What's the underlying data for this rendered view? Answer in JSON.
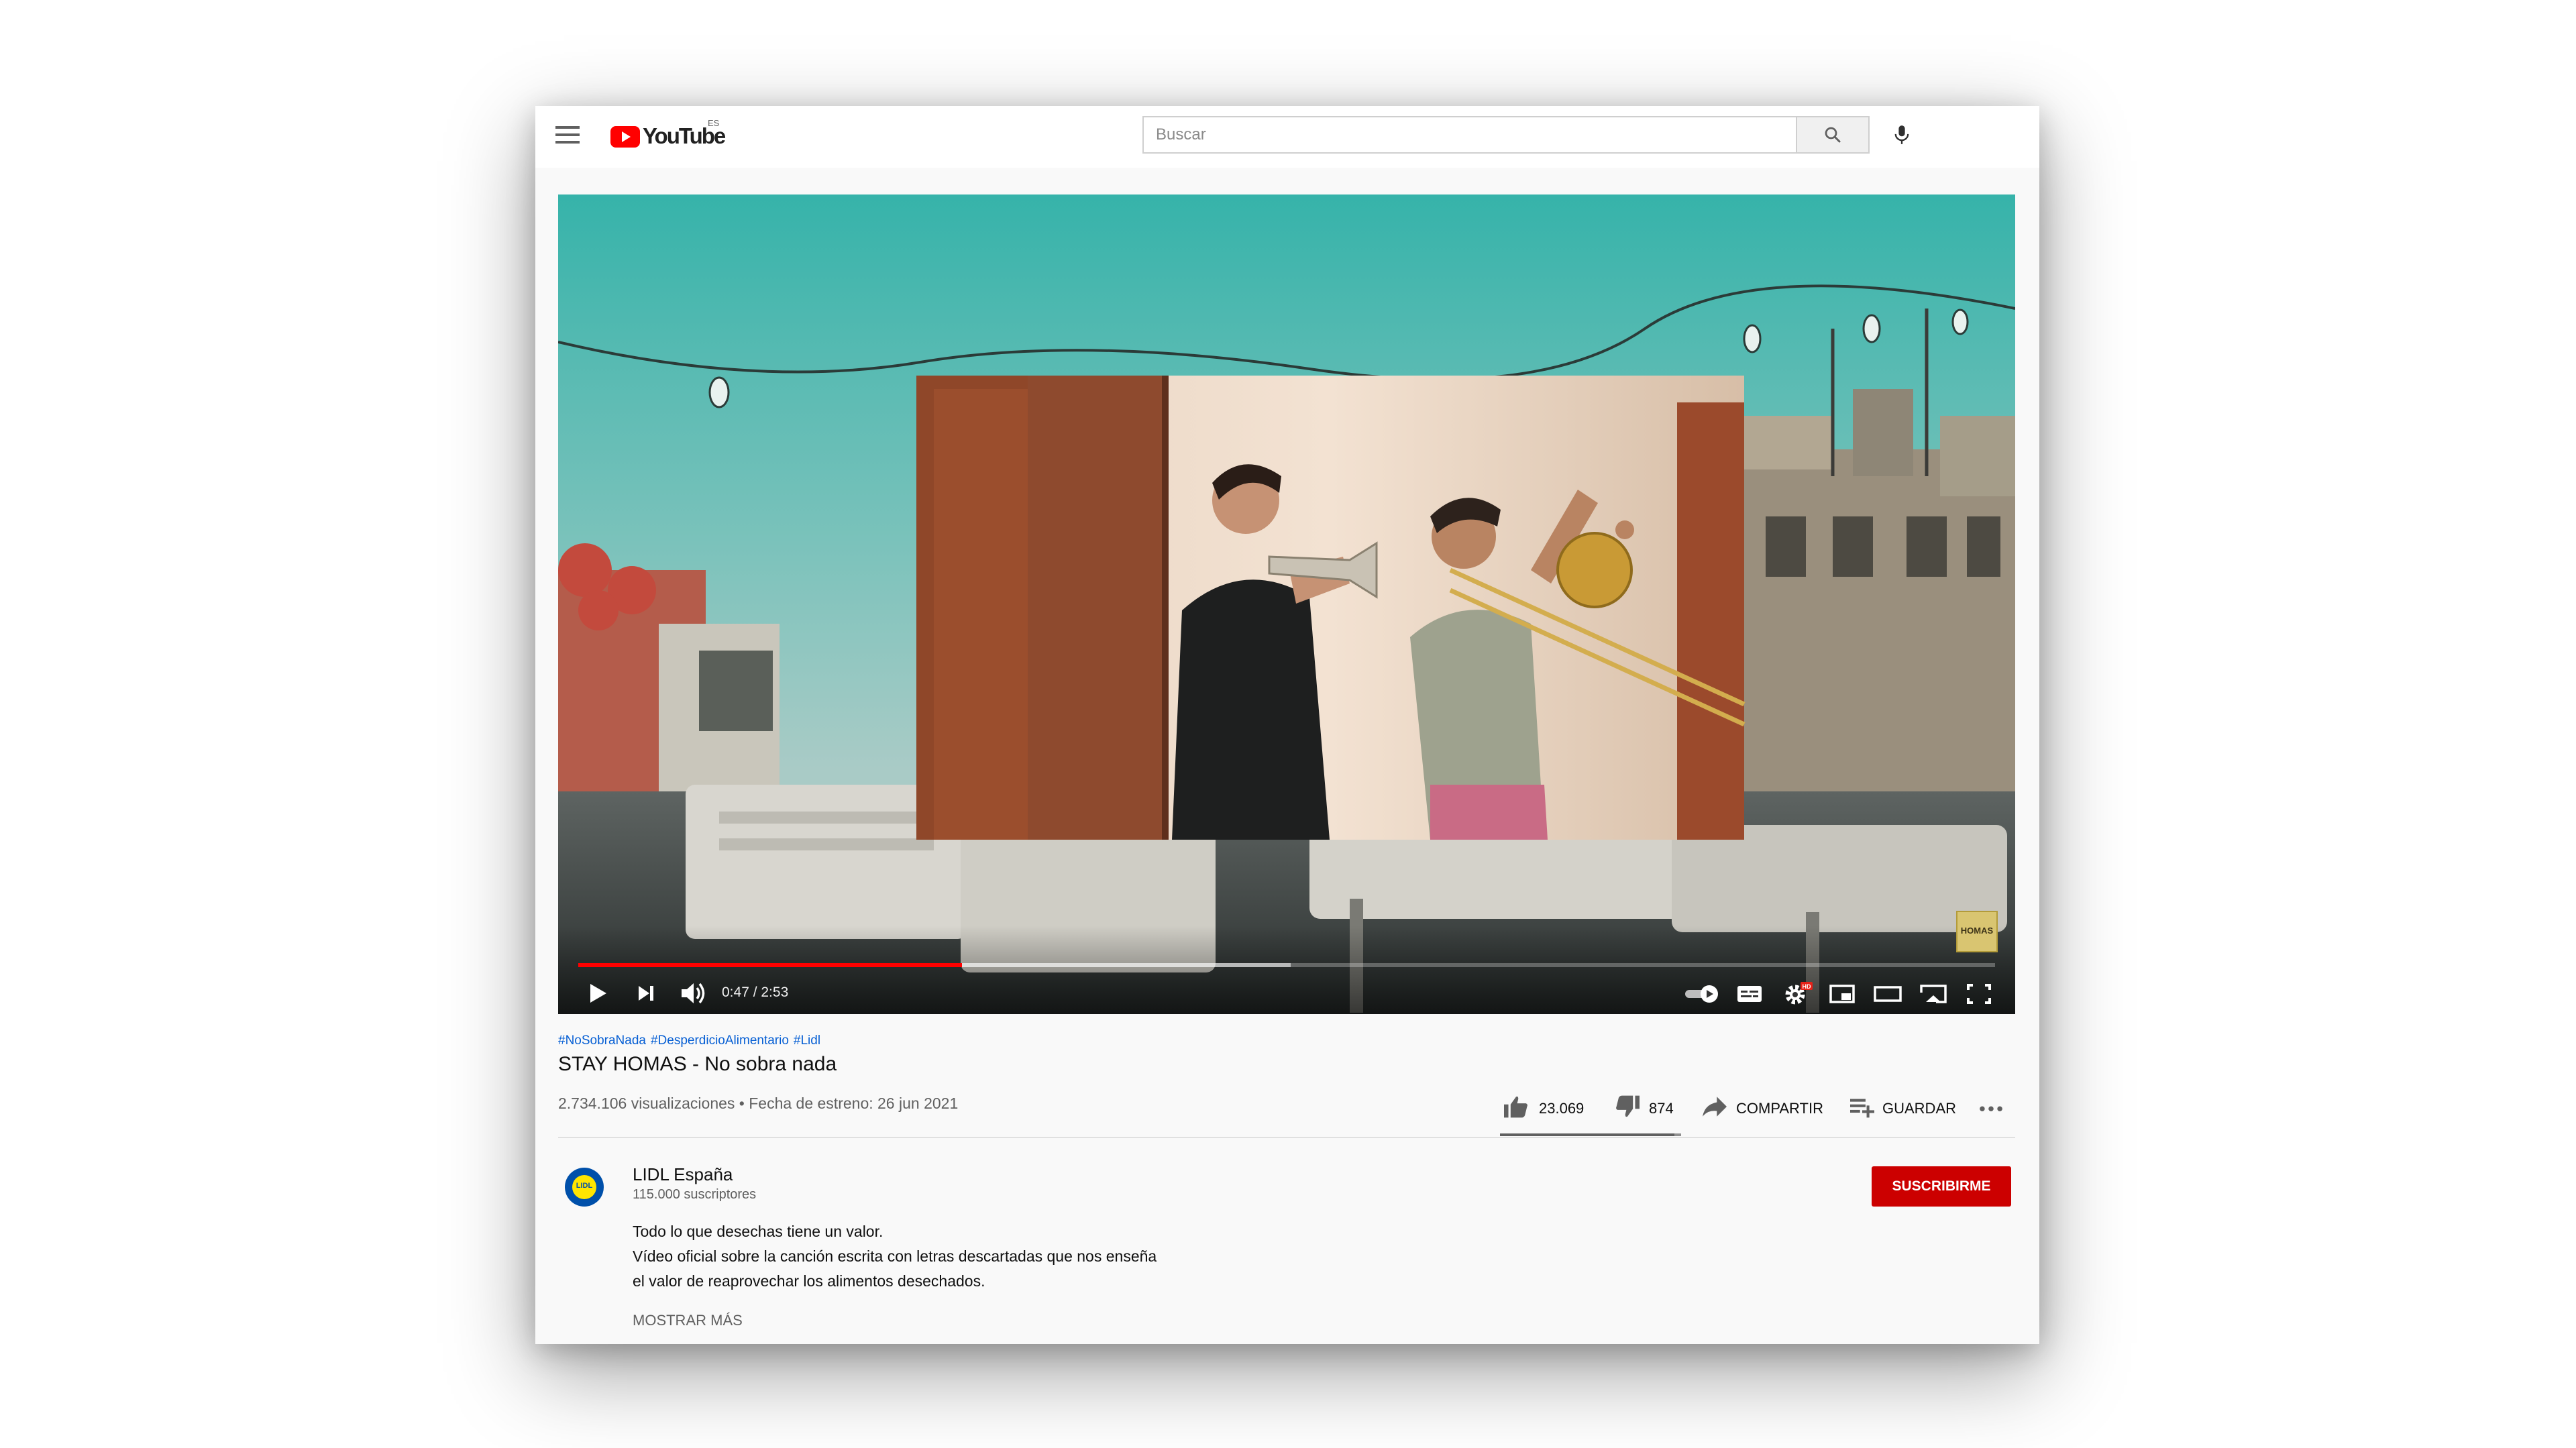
{
  "masthead": {
    "logo_text": "YouTube",
    "region": "ES",
    "search_placeholder": "Buscar"
  },
  "player": {
    "time_current": "0:47",
    "time_total": "2:53",
    "time_display": "0:47 / 2:53",
    "progress_fraction": 0.271,
    "buffered_fraction": 0.503,
    "watermark_text": "HOMAS",
    "settings_badge": "HD",
    "autoplay_on": false
  },
  "video": {
    "hashtags": [
      "#NoSobraNada",
      "#DesperdicioAlimentario",
      "#Lidl"
    ],
    "title": "STAY HOMAS - No sobra nada",
    "meta": "2.734.106 visualizaciones • Fecha de estreno: 26 jun 2021"
  },
  "actions": {
    "likes": "23.069",
    "dislikes": "874",
    "share_label": "COMPARTIR",
    "save_label": "GUARDAR",
    "like_ratio": 0.963
  },
  "channel": {
    "name": "LIDL España",
    "subscribers": "115.000 suscriptores",
    "avatar_text": "LIDL",
    "subscribe_label": "SUSCRIBIRME"
  },
  "description": {
    "lines": [
      "Todo lo que desechas tiene un valor.",
      "Vídeo oficial sobre la canción escrita con letras descartadas que nos enseña",
      "el valor de reaprovechar los alimentos desechados."
    ],
    "show_more": "MOSTRAR MÁS"
  },
  "colors": {
    "brand_red": "#ff0000",
    "subscribe_red": "#cc0000",
    "link_blue": "#065fd4",
    "secondary_text": "#606060"
  },
  "icons": {
    "menu": "hamburger-menu-icon",
    "search": "search-icon",
    "mic": "microphone-icon",
    "play": "play-icon",
    "next": "next-icon",
    "volume": "volume-icon",
    "autoplay": "autoplay-toggle-icon",
    "subtitles": "subtitles-icon",
    "settings": "gear-icon",
    "miniplayer": "miniplayer-icon",
    "theater": "theater-mode-icon",
    "cast": "cast-icon",
    "fullscreen": "fullscreen-icon",
    "like": "thumbs-up-icon",
    "dislike": "thumbs-down-icon",
    "share": "share-arrow-icon",
    "save": "playlist-add-icon",
    "more": "more-horizontal-icon"
  }
}
